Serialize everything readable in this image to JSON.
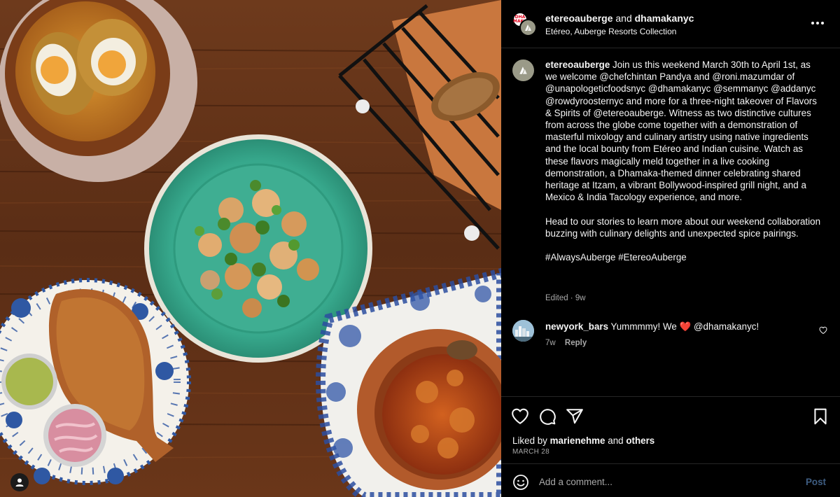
{
  "header": {
    "user_primary": "etereoauberge",
    "connector": "and",
    "user_collab": "dhamakanyc",
    "subtitle": "Etéreo, Auberge Resorts Collection",
    "collab_avatar_text": "DHA MAKA"
  },
  "caption": {
    "username": "etereoauberge",
    "paragraph1": "Join us this weekend March 30th to April 1st, as we welcome @chefchintan Pandya and @roni.mazumdar of @unapologeticfoodsnyc @dhamakanyc @semmanyc @addanyc @rowdyroosternyc and more for a three-night takeover of Flavors & Spirits of @etereoauberge. Witness as two distinctive cultures from across the globe come together with a demonstration of masterful mixology and culinary artistry using native ingredients and the local bounty from Etéreo and Indian cuisine. Watch as these flavors magically meld together in a live cooking demonstration, a Dhamaka-themed dinner celebrating shared heritage at Itzam, a vibrant Bollywood-inspired grill night, and a Mexico & India Tacology experience, and more.",
    "paragraph2": "Head to our stories to learn more about our weekend collaboration buzzing with culinary delights and unexpected spice pairings.",
    "hashtags": "#AlwaysAuberge #EtereoAuberge",
    "meta": "Edited · 9w"
  },
  "comment": {
    "username": "newyork_bars",
    "text_before": "Yummmmy! We",
    "heart_emoji": "❤️",
    "text_after": "@dhamakanyc!",
    "time": "7w",
    "reply_label": "Reply"
  },
  "likes": {
    "prefix": "Liked by",
    "user": "marienehme",
    "middle": "and",
    "others": "others"
  },
  "date": "MARCH 28",
  "comment_bar": {
    "placeholder": "Add a comment...",
    "post_label": "Post"
  },
  "icons": [
    "more-icon",
    "like-icon",
    "comment-icon",
    "share-icon",
    "save-icon",
    "emoji-icon",
    "heart-outline-icon",
    "user-tag-icon"
  ],
  "colors": {
    "background": "#000000",
    "text": "#f5f5f5",
    "muted": "#a8a8a8",
    "divider": "#262626",
    "post_button": "#3f5e83",
    "heart": "#ed1c24"
  }
}
